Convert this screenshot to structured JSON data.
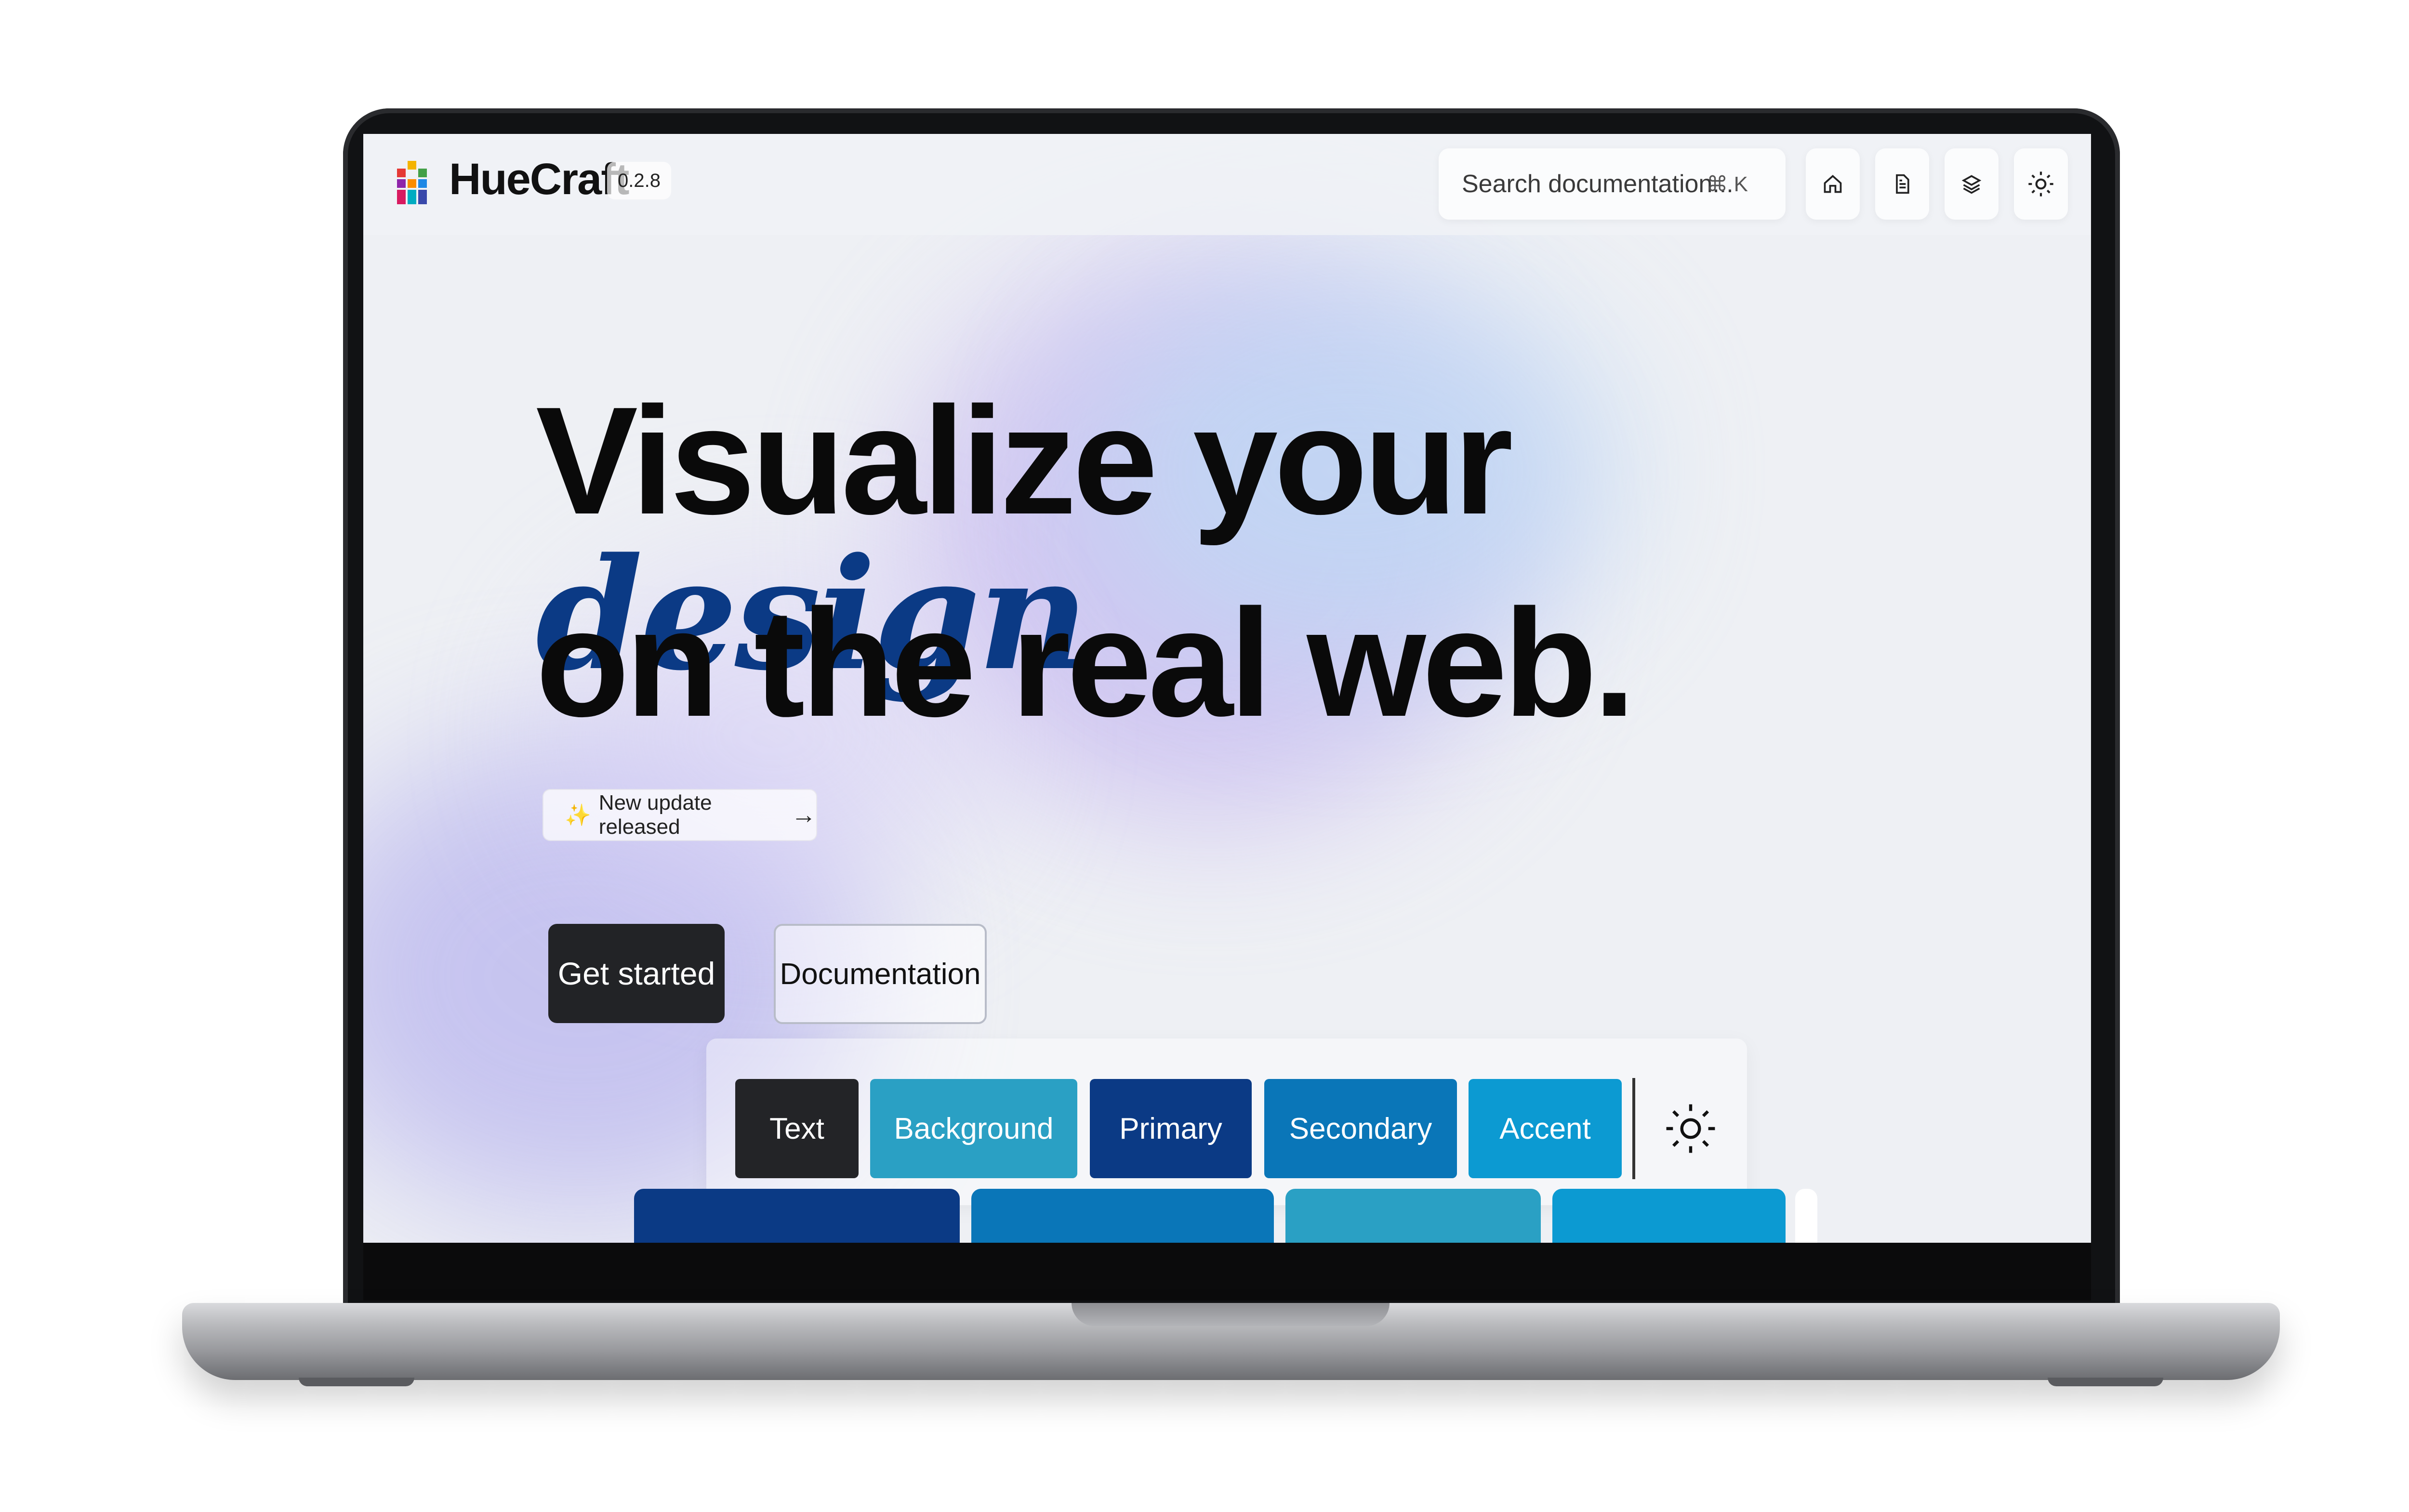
{
  "app": {
    "brand": "HueCraft",
    "version": "0.2.8"
  },
  "nav": {
    "search_placeholder": "Search documentation...",
    "search_shortcut": "⌘ K",
    "icons": [
      "home-icon",
      "document-icon",
      "layers-icon",
      "sun-icon"
    ]
  },
  "hero": {
    "line1_prefix": "Visualize your ",
    "line1_accent": "design",
    "line2": "on the real web.",
    "update_pill": "New update released",
    "update_arrow": "→",
    "cta_primary": "Get started",
    "cta_secondary": "Documentation"
  },
  "palette": {
    "chips": [
      {
        "label": "Text",
        "color": "#232427"
      },
      {
        "label": "Background",
        "color": "#2aa0c4"
      },
      {
        "label": "Primary",
        "color": "#0b3a85"
      },
      {
        "label": "Secondary",
        "color": "#0a76b8"
      },
      {
        "label": "Accent",
        "color": "#0c9ad2"
      }
    ]
  },
  "colors": {
    "accent_text": "#0b3a85",
    "strip_1": "#0b3a85",
    "strip_2": "#0a76b8",
    "strip_3": "#2aa0c4",
    "strip_4": "#0c9ad2"
  }
}
